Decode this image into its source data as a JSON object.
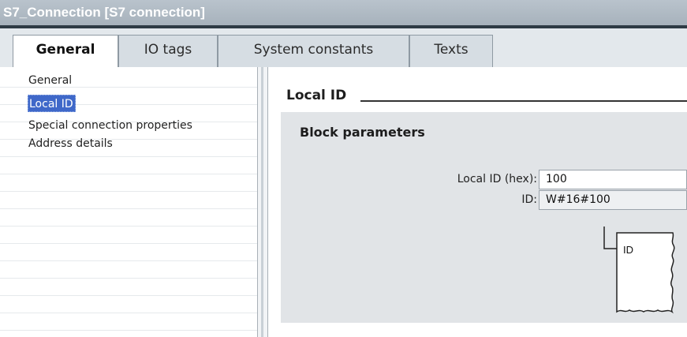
{
  "window": {
    "title": "S7_Connection [S7 connection]"
  },
  "tabs": [
    {
      "label": "General",
      "active": true
    },
    {
      "label": "IO tags",
      "active": false
    },
    {
      "label": "System constants",
      "active": false
    },
    {
      "label": "Texts",
      "active": false
    }
  ],
  "nav": {
    "items": [
      {
        "label": "General",
        "selected": false
      },
      {
        "label": "Local ID",
        "selected": true
      },
      {
        "label": "Special connection properties",
        "selected": false
      },
      {
        "label": "Address details",
        "selected": false
      }
    ]
  },
  "section": {
    "title": "Local ID"
  },
  "block_parameters": {
    "title": "Block parameters",
    "local_id_label": "Local ID (hex):",
    "local_id_value": "100",
    "id_label": "ID:",
    "id_value": "W#16#100",
    "diagram_pin_label": "ID"
  },
  "colors": {
    "titlebar": "#a7b2bc",
    "selection": "#3f68c9",
    "group_background": "#e1e4e7",
    "tab_border": "#2e3b45"
  }
}
